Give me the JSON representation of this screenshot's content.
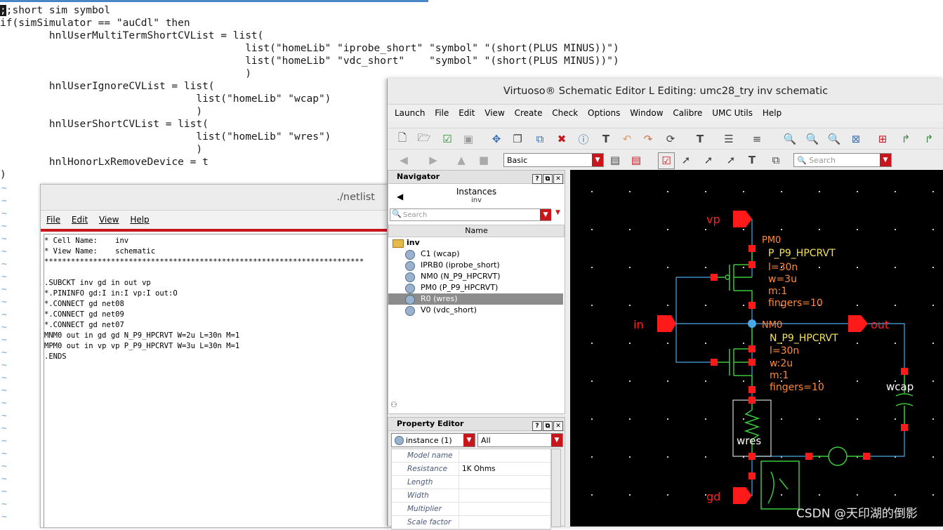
{
  "vim": {
    "lines": [
      ";;short sim symbol",
      "if(simSimulator == \"auCdl\" then",
      "        hnlUserMultiTermShortCVList = list(",
      "                                        list(\"homeLib\" \"iprobe_short\" \"symbol\" \"(short(PLUS MINUS))\")",
      "                                        list(\"homeLib\" \"vdc_short\"    \"symbol\" \"(short(PLUS MINUS))\")",
      "                                        )",
      "        hnlUserIgnoreCVList = list(",
      "                                list(\"homeLib\" \"wcap\")",
      "                                )",
      "        hnlUserShortCVList = list(",
      "                                list(\"homeLib\" \"wres\")",
      "                                )",
      "        hnlHonorLxRemoveDevice = t",
      ")"
    ],
    "tilde": "~"
  },
  "netlist_window": {
    "title": "./netlist",
    "menu": [
      "File",
      "Edit",
      "View",
      "Help"
    ],
    "lines": [
      "* Cell Name:    inv",
      "* View Name:    schematic",
      "************************************************************************",
      "",
      ".SUBCKT inv gd in out vp",
      "*.PININFO gd:I in:I vp:I out:O",
      "*.CONNECT gd net08",
      "*.CONNECT gd net09",
      "*.CONNECT gd net07",
      "MNM0 out in gd gd N_P9_HPCRVT W=2u L=30n M=1",
      "MPM0 out in vp vp P_P9_HPCRVT W=3u L=30n M=1",
      ".ENDS"
    ]
  },
  "virtuoso": {
    "title": "Virtuoso® Schematic Editor L Editing: umc28_try inv schematic",
    "menu": [
      "Launch",
      "File",
      "Edit",
      "View",
      "Create",
      "Check",
      "Options",
      "Window",
      "Calibre",
      "UMC Utils",
      "Help"
    ],
    "toolbar2": {
      "filter_value": "Basic",
      "search_placeholder": "Search"
    },
    "navigator": {
      "header": "Navigator",
      "title": "Instances",
      "subtitle": "inv",
      "search_placeholder": "Search",
      "column": "Name",
      "root": "inv",
      "items": [
        "C1 (wcap)",
        "IPRB0 (iprobe_short)",
        "NM0 (N_P9_HPCRVT)",
        "PM0 (P_P9_HPCRVT)",
        "R0 (wres)",
        "V0 (vdc_short)"
      ],
      "selected_index": 4
    },
    "property_editor": {
      "header": "Property Editor",
      "instance_select": "instance (1)",
      "filter_select": "All",
      "rows": [
        {
          "key": "Model name",
          "value": ""
        },
        {
          "key": "Resistance",
          "value": "1K Ohms"
        },
        {
          "key": "Length",
          "value": ""
        },
        {
          "key": "Width",
          "value": ""
        },
        {
          "key": "Multiplier",
          "value": ""
        },
        {
          "key": "Scale factor",
          "value": ""
        }
      ]
    },
    "schematic": {
      "pins": {
        "vp": "vp",
        "in": "in",
        "out": "out",
        "gd": "gd"
      },
      "pm0": {
        "name": "PM0",
        "model": "P_P9_HPCRVT",
        "l": "l=30n",
        "w": "w=3u",
        "m": "m:1",
        "fingers": "fingers=10"
      },
      "nm0": {
        "name": "NM0",
        "model": "N_P9_HPCRVT",
        "l": "l=30n",
        "w": "w:2u",
        "m": "m:1",
        "fingers": "fingers=10"
      },
      "wcap": "wcap",
      "wres": "wres"
    }
  },
  "watermark": "CSDN @天印湖的倒影",
  "colors": {
    "accent_red": "#c8161d",
    "pin_red": "#ff1a1a",
    "wire_blue": "#4aa8e8",
    "label_yellow": "#f5e25a",
    "label_orange": "#ff8a3a"
  }
}
